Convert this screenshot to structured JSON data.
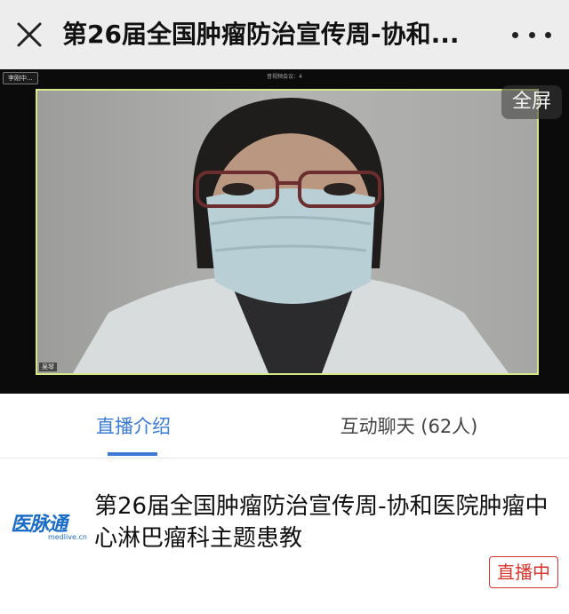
{
  "nav": {
    "title": "第26届全国肿瘤防治宣传周-协和...",
    "close_icon": "close-icon",
    "more_icon": "more-dots-icon"
  },
  "player": {
    "conference_chip": "李刚中...",
    "strip_label": "音视频会议：4",
    "name_tag": "吴琴",
    "fullscreen_label": "全屏"
  },
  "tabs": [
    {
      "label": "直播介绍",
      "active": true
    },
    {
      "label": "互动聊天 (62人)",
      "active": false
    }
  ],
  "info": {
    "logo_text": "医脉通",
    "logo_sub": "medlive.cn",
    "title": "第26届全国肿瘤防治宣传周-协和医院肿瘤中心淋巴瘤科主题患教",
    "status_badge": "直播中"
  },
  "colors": {
    "accent": "#3a7ad6",
    "live_red": "#d9352f",
    "frame_border": "#d6e98a",
    "logo_blue": "#1b6cc7"
  }
}
